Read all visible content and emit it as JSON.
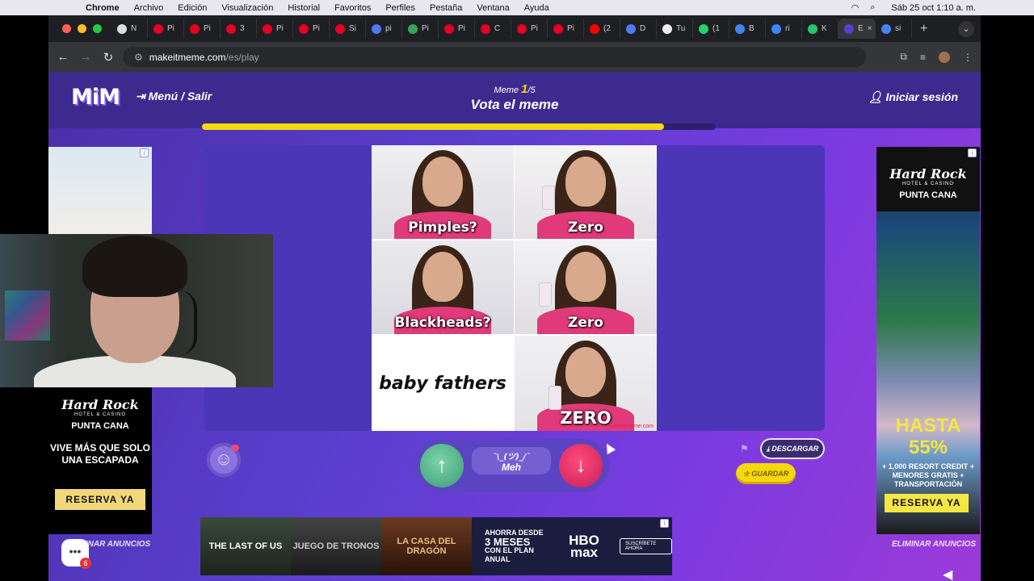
{
  "menubar": {
    "app_name": "Chrome",
    "items": [
      "Archivo",
      "Edición",
      "Visualización",
      "Historial",
      "Favoritos",
      "Perfiles",
      "Pestaña",
      "Ventana",
      "Ayuda"
    ],
    "clock": "Sáb 25 oct  1:10 a. m."
  },
  "tabs": [
    {
      "label": "N",
      "color": "#dddddd"
    },
    {
      "label": "Pi",
      "color": "#e60023"
    },
    {
      "label": "Pi",
      "color": "#e60023"
    },
    {
      "label": "3",
      "color": "#e60023"
    },
    {
      "label": "Pi",
      "color": "#e60023"
    },
    {
      "label": "Pi",
      "color": "#e60023"
    },
    {
      "label": "Si",
      "color": "#e60023"
    },
    {
      "label": "pi",
      "color": "#4a7cf0"
    },
    {
      "label": "Pi",
      "color": "#3aa35a"
    },
    {
      "label": "Pi",
      "color": "#e60023"
    },
    {
      "label": "C",
      "color": "#e60023"
    },
    {
      "label": "Pi",
      "color": "#e60023"
    },
    {
      "label": "Pi",
      "color": "#e60023"
    },
    {
      "label": "(2",
      "color": "#ff0000"
    },
    {
      "label": "D",
      "color": "#4a7cf0"
    },
    {
      "label": "Tu",
      "color": "#eeeeee"
    },
    {
      "label": "(1",
      "color": "#25d366"
    },
    {
      "label": "B",
      "color": "#4285f4"
    },
    {
      "label": "ri",
      "color": "#4285f4"
    },
    {
      "label": "K",
      "color": "#2ac46a"
    },
    {
      "label": "E",
      "color": "#5a3fd0",
      "active": true
    },
    {
      "label": "si",
      "color": "#4285f4"
    }
  ],
  "url": {
    "host": "makeitmeme.com",
    "path": "/es/play"
  },
  "site": {
    "logo": "MiM",
    "menu_salir": "Menú / Salir",
    "meme_label": "Meme",
    "meme_current": "1",
    "meme_total": "/5",
    "title": "Vota el meme",
    "login": "Iniciar sesión",
    "progress": 0.9
  },
  "meme": {
    "captions": [
      "Pimples?",
      "Zero",
      "Blackheads?",
      "Zero",
      "baby fathers",
      "ZERO"
    ],
    "watermark": "makeitmeme.com"
  },
  "vote": {
    "up_icon": "arrow-up-icon",
    "down_icon": "arrow-down-icon",
    "meh_shrug": "¯\\_(ツ)_/¯",
    "meh_label": "Meh"
  },
  "actions": {
    "descargar": "DESCARGAR",
    "guardar": "GUARDAR",
    "eliminar_anuncios": "ELIMINAR ANUNCIOS"
  },
  "ad_left": {
    "brand": "Hard Rock",
    "brand_sub": "HOTEL & CASINO",
    "place": "PUNTA CANA",
    "text": "VIVE MÁS QUE SOLO UNA ESCAPADA",
    "cta": "RESERVA YA"
  },
  "ad_right": {
    "brand": "Hard Rock",
    "brand_sub": "HOTEL & CASINO",
    "place": "PUNTA CANA",
    "hasta": "HASTA",
    "pct": "55%",
    "details": "+ 1,000 RESORT CREDIT + MENORES GRATIS + TRANSPORTACIÓN",
    "cta": "RESERVA YA"
  },
  "ad_bottom": {
    "posters": [
      "THE LAST OF US",
      "JUEGO DE TRONOS",
      "LA CASA DEL DRAGÓN"
    ],
    "offer_line1": "AHORRA DESDE",
    "offer_line2": "3 MESES",
    "offer_line3": "CON EL PLAN ANUAL",
    "brand": "HBO max",
    "cta": "SUSCRÍBETE AHORA"
  },
  "chat_badge": "6",
  "colors": {
    "accent_yellow": "#f5d90a",
    "up_green": "#3a9a74",
    "down_red": "#c81e5a",
    "header_purple": "#3d2a8e"
  }
}
